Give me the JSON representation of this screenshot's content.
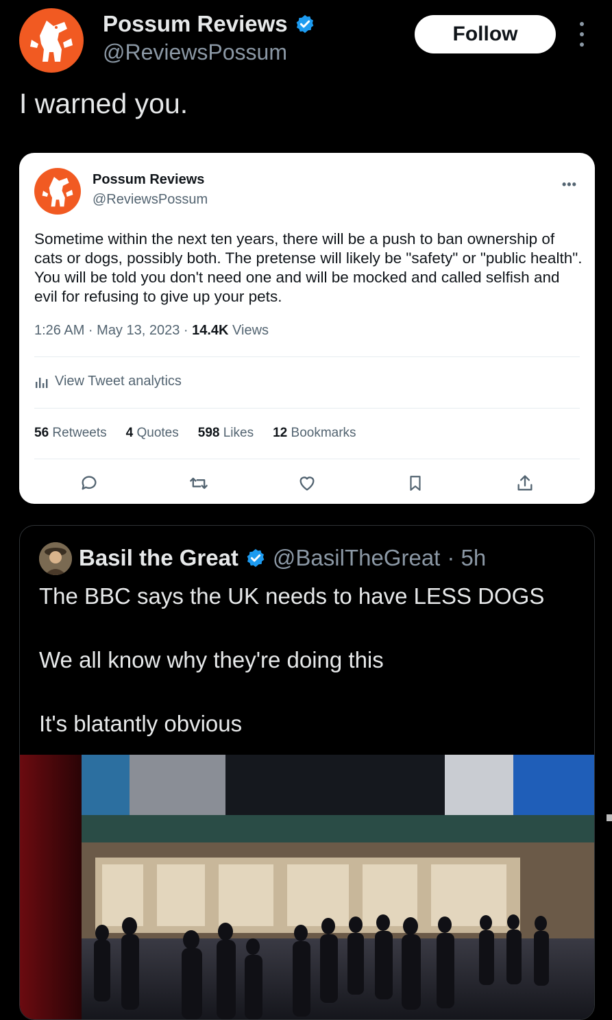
{
  "header": {
    "name": "Possum Reviews",
    "handle": "@ReviewsPossum",
    "follow_label": "Follow",
    "tweet_text": "I warned you."
  },
  "quoted_card": {
    "name": "Possum Reviews",
    "handle": "@ReviewsPossum",
    "dots": "•••",
    "body": "Sometime within the next ten years, there will be a push to ban ownership of cats or dogs, possibly both. The pretense will likely be \"safety\" or \"public health\". You will be told you don't need one and will be mocked and called selfish and evil for refusing to give up your pets.",
    "time": "1:26 AM · May 13, 2023 · ",
    "views_count": "14.4K",
    "views_label": " Views",
    "analytics_label": "View Tweet analytics",
    "stats": [
      {
        "count": "56",
        "label": "Retweets"
      },
      {
        "count": "4",
        "label": "Quotes"
      },
      {
        "count": "598",
        "label": "Likes"
      },
      {
        "count": "12",
        "label": "Bookmarks"
      }
    ]
  },
  "embedded_tweet": {
    "name": "Basil the Great",
    "handle": "@BasilTheGreat",
    "time": "· 5h",
    "lines": [
      "The BBC says the UK needs to have LESS DOGS",
      "We all know why they're doing this",
      "It's blatantly obvious"
    ]
  },
  "colors": {
    "brand_orange": "#f15a22",
    "verified_blue": "#1d9bf0",
    "background": "#000000"
  }
}
